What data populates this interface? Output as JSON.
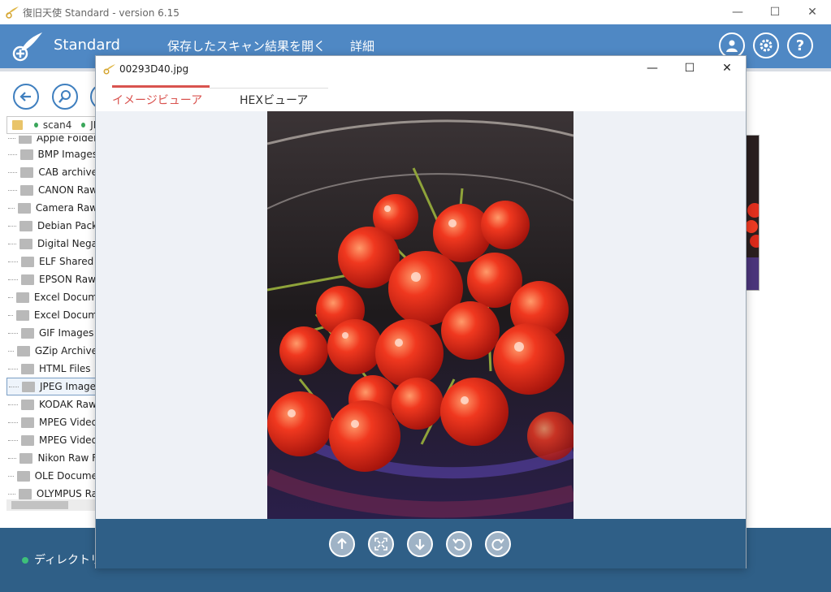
{
  "app": {
    "window_title": "復旧天使 Standard - version 6.15",
    "brand": "Standard",
    "menu": [
      "保存したスキャン結果を開く",
      "詳細"
    ],
    "colors": {
      "header": "#4f88c4",
      "footer": "#2f5f87",
      "accent_tab": "#d9534f"
    }
  },
  "window_controls": [
    "minimize",
    "maximize",
    "close"
  ],
  "header_icons": [
    "user-icon",
    "gear-icon",
    "help-icon"
  ],
  "toolbar_icons": [
    "back-arrow-icon",
    "search-icon"
  ],
  "path": {
    "segments": [
      "scan4",
      "JP"
    ]
  },
  "tree": {
    "items": [
      "Apple Folder",
      "BMP Images",
      "CAB archive",
      "CANON Raw",
      "Camera Raw",
      "Debian Pack",
      "Digital Nega",
      "ELF Shared",
      "EPSON Raw",
      "Excel Docum",
      "Excel Docum",
      "GIF Images",
      "GZip Archive",
      "HTML Files",
      "JPEG Image",
      "KODAK Raw",
      "MPEG Video",
      "MPEG Video",
      "Nikon Raw F",
      "OLE Docume",
      "OLYMPUS Ra"
    ],
    "selected_index": 14
  },
  "status": {
    "text": "ディレクトリ"
  },
  "viewer": {
    "filename": "00293D40.jpg",
    "tabs": [
      "イメージビューア",
      "HEXビューア"
    ],
    "active_tab": 0,
    "image_description_icon": "cherries-photo",
    "controls": [
      "arrow-up-icon",
      "fit-screen-icon",
      "arrow-down-icon",
      "rotate-left-icon",
      "rotate-right-icon"
    ]
  }
}
